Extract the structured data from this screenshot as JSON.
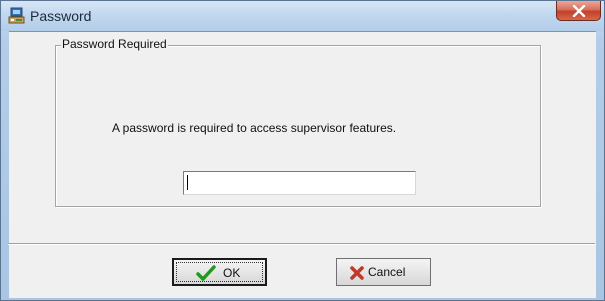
{
  "window": {
    "title": "Password",
    "icon": "app-computer-icon",
    "close_icon": "close-x-icon"
  },
  "group": {
    "title": "Password Required",
    "message": "A password is required to access supervisor features."
  },
  "password_field": {
    "value": "",
    "placeholder": ""
  },
  "buttons": {
    "ok_label": "OK",
    "ok_icon": "checkmark-icon",
    "cancel_label": "Cancel",
    "cancel_icon": "red-x-icon"
  },
  "colors": {
    "ok_check": "#1f9a1f",
    "cancel_x": "#c0392b",
    "close_button": "#c2402a"
  }
}
